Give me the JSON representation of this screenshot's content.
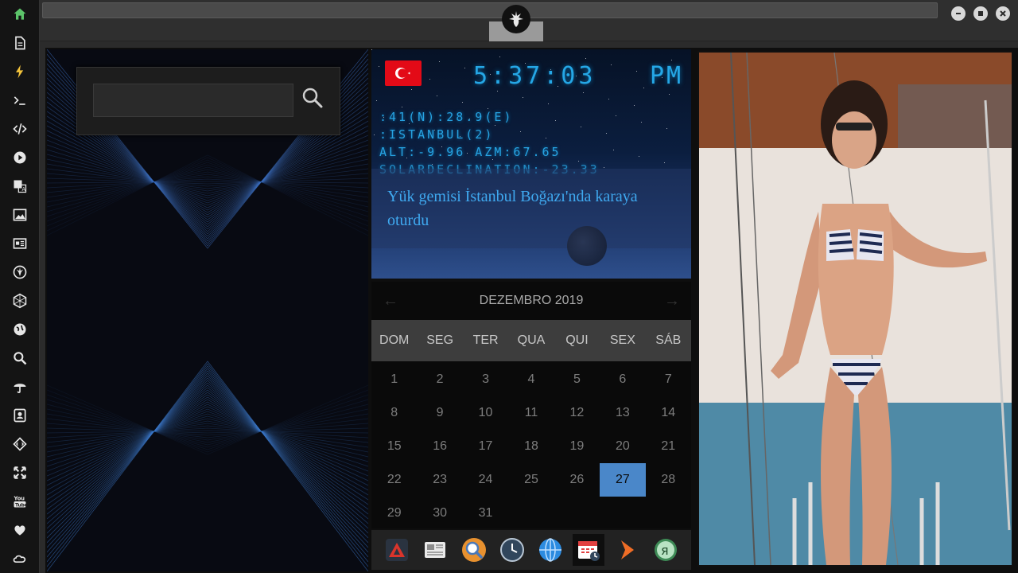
{
  "sidebar": {
    "items": [
      {
        "name": "home-icon",
        "glyph": "home",
        "color": "#5cc46a"
      },
      {
        "name": "document-icon",
        "glyph": "doc"
      },
      {
        "name": "lightning-icon",
        "glyph": "bolt",
        "color": "#f3c33b"
      },
      {
        "name": "terminal-icon",
        "glyph": "term"
      },
      {
        "name": "code-icon",
        "glyph": "code"
      },
      {
        "name": "play-icon",
        "glyph": "play"
      },
      {
        "name": "translate-icon",
        "glyph": "trans"
      },
      {
        "name": "image-icon",
        "glyph": "img"
      },
      {
        "name": "news-icon",
        "glyph": "news"
      },
      {
        "name": "rebel-alliance-icon",
        "glyph": "rebel"
      },
      {
        "name": "hexagon-icon",
        "glyph": "hex"
      },
      {
        "name": "globe-icon",
        "glyph": "globe"
      },
      {
        "name": "search-icon",
        "glyph": "search"
      },
      {
        "name": "umbrella-icon",
        "glyph": "umb"
      },
      {
        "name": "contacts-icon",
        "glyph": "contact"
      },
      {
        "name": "diamond-code-icon",
        "glyph": "diamond"
      },
      {
        "name": "expand-icon",
        "glyph": "expand"
      },
      {
        "name": "youtube-icon",
        "glyph": "yt"
      },
      {
        "name": "heart-icon",
        "glyph": "heart"
      },
      {
        "name": "cloud-icon",
        "glyph": "cloud"
      }
    ]
  },
  "search": {
    "value": "",
    "placeholder": ""
  },
  "clock": {
    "time": "5:37:03",
    "ampm": "PM",
    "coords": ":41(N):28.9(E)",
    "city": ":ISTANBUL(2)",
    "altaz": "ALT:-9.96 AZM:67.65",
    "solar": "SOLARDECLINATION:-23.33"
  },
  "news": {
    "headline": "Yük gemisi İstanbul Boğazı'nda karaya oturdu"
  },
  "calendar": {
    "month_title": "DEZEMBRO 2019",
    "weekdays": [
      "DOM",
      "SEG",
      "TER",
      "QUA",
      "QUI",
      "SEX",
      "SÁB"
    ],
    "days": [
      "1",
      "2",
      "3",
      "4",
      "5",
      "6",
      "7",
      "8",
      "9",
      "10",
      "11",
      "12",
      "13",
      "14",
      "15",
      "16",
      "17",
      "18",
      "19",
      "20",
      "21",
      "22",
      "23",
      "24",
      "25",
      "26",
      "27",
      "28",
      "29",
      "30",
      "31"
    ],
    "today": "27"
  },
  "dock": {
    "items": [
      {
        "name": "red-triangle-app-icon"
      },
      {
        "name": "newspaper-app-icon"
      },
      {
        "name": "search-app-icon"
      },
      {
        "name": "clock-app-icon"
      },
      {
        "name": "browser-globe-app-icon"
      },
      {
        "name": "calendar-app-icon",
        "active": true
      },
      {
        "name": "arrow-app-icon"
      },
      {
        "name": "yandex-app-icon"
      }
    ]
  },
  "colors": {
    "accent": "#25a7e6",
    "today": "#4a87c9",
    "flag": "#e30a17"
  }
}
